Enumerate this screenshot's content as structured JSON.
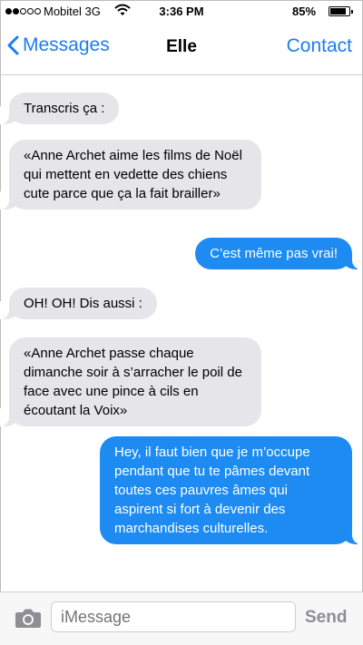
{
  "status_bar": {
    "carrier": "Mobitel 3G",
    "time": "3:36 PM",
    "battery_percent": "85%",
    "battery_level": 0.85,
    "signal_bars_filled": 2,
    "signal_bars_total": 5
  },
  "nav": {
    "back_label": "Messages",
    "title": "Elle",
    "contact_label": "Contact"
  },
  "messages": [
    {
      "from": "them",
      "text": "Transcris ça :"
    },
    {
      "from": "them",
      "text": "«Anne Archet aime les films de Noël qui mettent en vedette des chiens cute parce que ça la fait brailler»"
    },
    {
      "from": "me",
      "text": "C’est même pas vrai!"
    },
    {
      "from": "them",
      "text": "OH! OH! Dis aussi :"
    },
    {
      "from": "them",
      "text": "«Anne Archet passe chaque dimanche soir à s’arracher le poil de face avec une pince à cils en écoutant la Voix»"
    },
    {
      "from": "me",
      "text": "Hey, il faut bien que je m’occupe pendant que tu te pâmes devant toutes ces pauvres âmes qui aspirent si fort à devenir des marchandises culturelles."
    }
  ],
  "input_bar": {
    "placeholder": "iMessage",
    "send_label": "Send"
  },
  "colors": {
    "accent": "#1d7cf2",
    "outgoing_bubble": "#1d8bf1",
    "incoming_bubble": "#e5e5ea"
  }
}
